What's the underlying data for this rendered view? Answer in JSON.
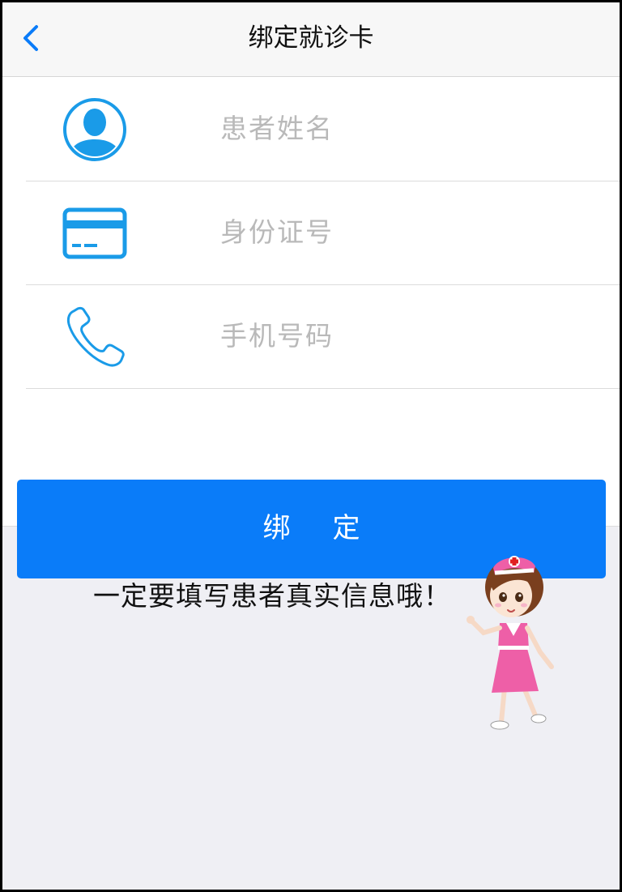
{
  "header": {
    "title": "绑定就诊卡",
    "back_icon": "chevron-left-icon"
  },
  "form": {
    "fields": [
      {
        "icon": "person-icon",
        "placeholder": "患者姓名",
        "value": ""
      },
      {
        "icon": "id-card-icon",
        "placeholder": "身份证号",
        "value": ""
      },
      {
        "icon": "phone-icon",
        "placeholder": "手机号码",
        "value": ""
      }
    ]
  },
  "actions": {
    "bind_label": "绑定"
  },
  "notice": {
    "text": "一定要填写患者真实信息哦！"
  },
  "colors": {
    "accent": "#0a7cf9",
    "icon_blue": "#1a9be8",
    "nurse_pink": "#ee5fa7"
  }
}
